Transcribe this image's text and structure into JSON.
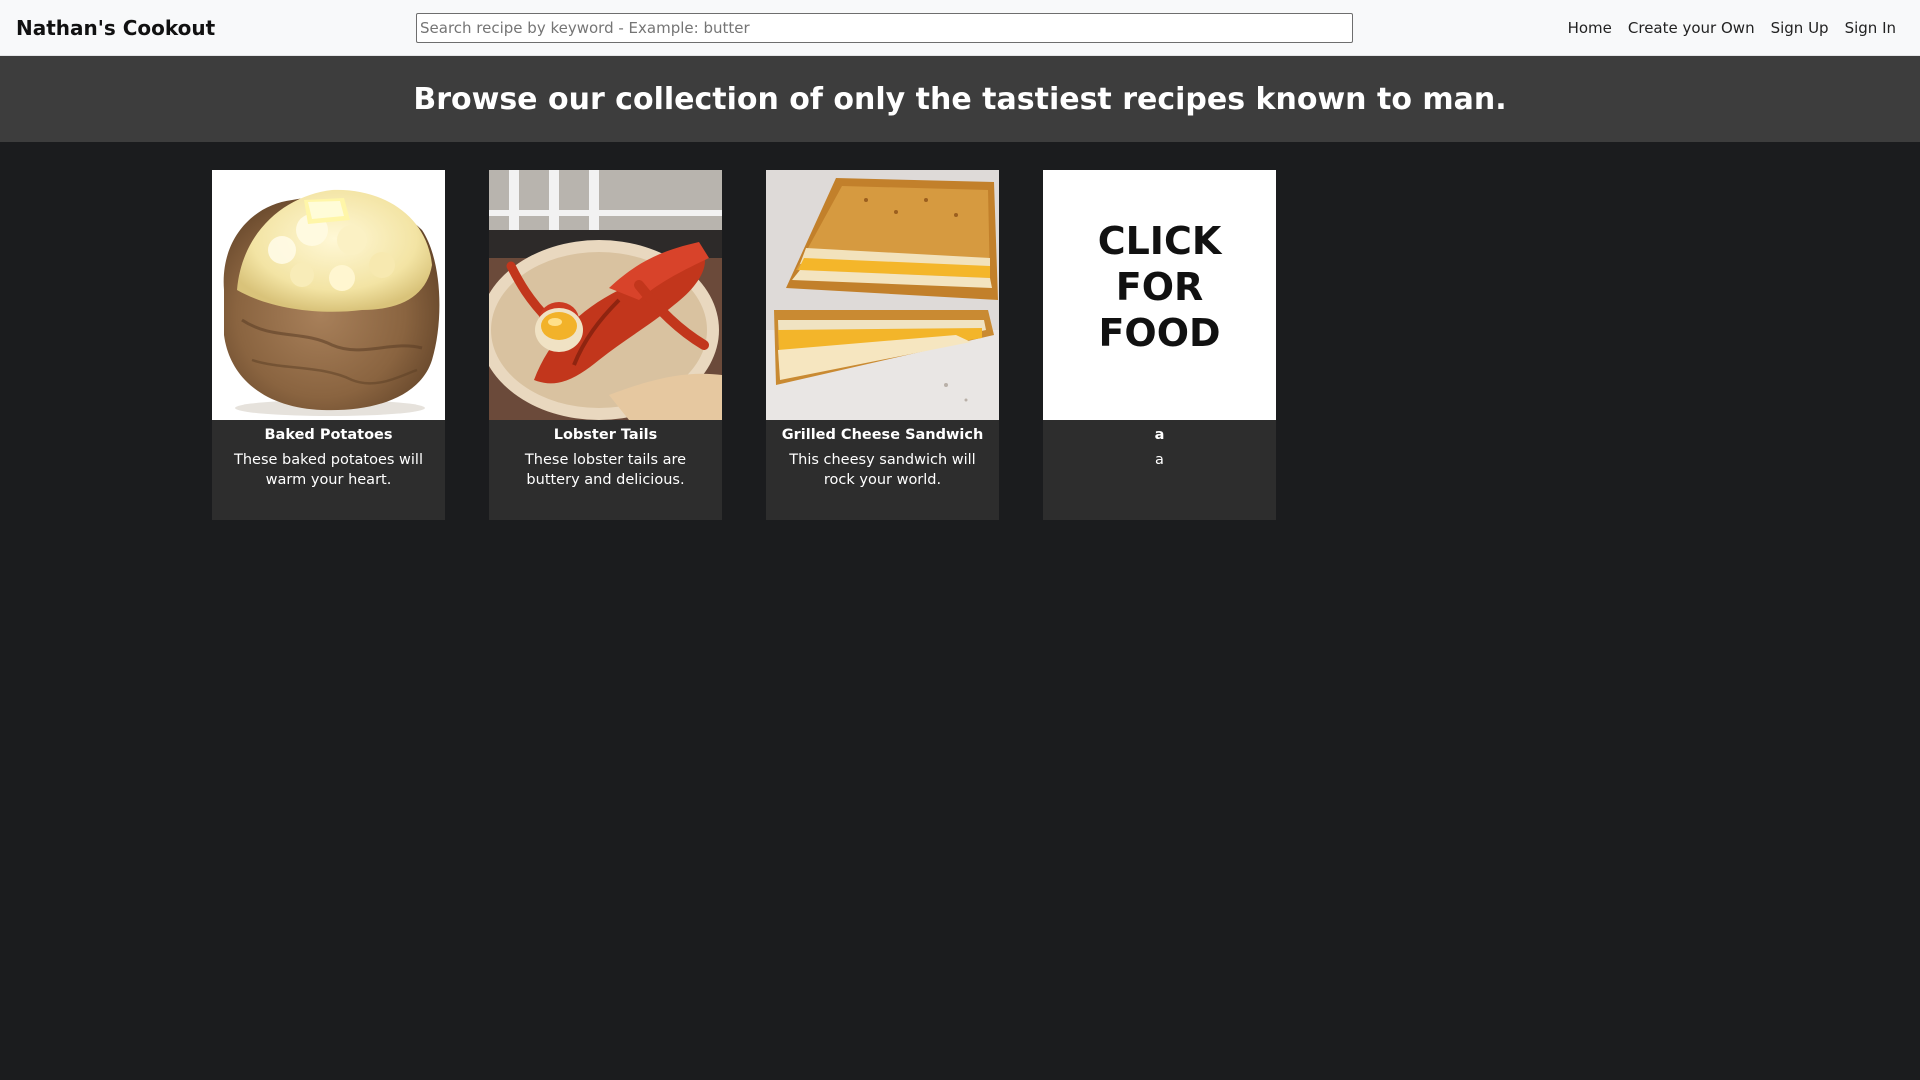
{
  "navbar": {
    "brand": "Nathan's Cookout",
    "search_placeholder": "Search recipe by keyword - Example: butter",
    "links": [
      "Home",
      "Create your Own",
      "Sign Up",
      "Sign In"
    ]
  },
  "banner": {
    "title": "Browse our collection of only the tastiest recipes known to man."
  },
  "recipes": [
    {
      "title": "Baked Potatoes",
      "description": "These baked potatoes will warm your heart.",
      "image": "baked-potato-image"
    },
    {
      "title": "Lobster Tails",
      "description": "These lobster tails are buttery and delicious.",
      "image": "lobster-image"
    },
    {
      "title": "Grilled Cheese Sandwich",
      "description": "This cheesy sandwich will rock your world.",
      "image": "grilled-cheese-image"
    },
    {
      "title": "a",
      "description": "a",
      "image": "click-for-food-image",
      "image_text": [
        "CLICK",
        "FOR",
        "FOOD"
      ]
    }
  ],
  "colors": {
    "navbar_bg": "#f8f9fa",
    "banner_bg": "#3d3d3d",
    "page_bg": "#1b1c1e",
    "card_bg": "#2d2d2d"
  }
}
